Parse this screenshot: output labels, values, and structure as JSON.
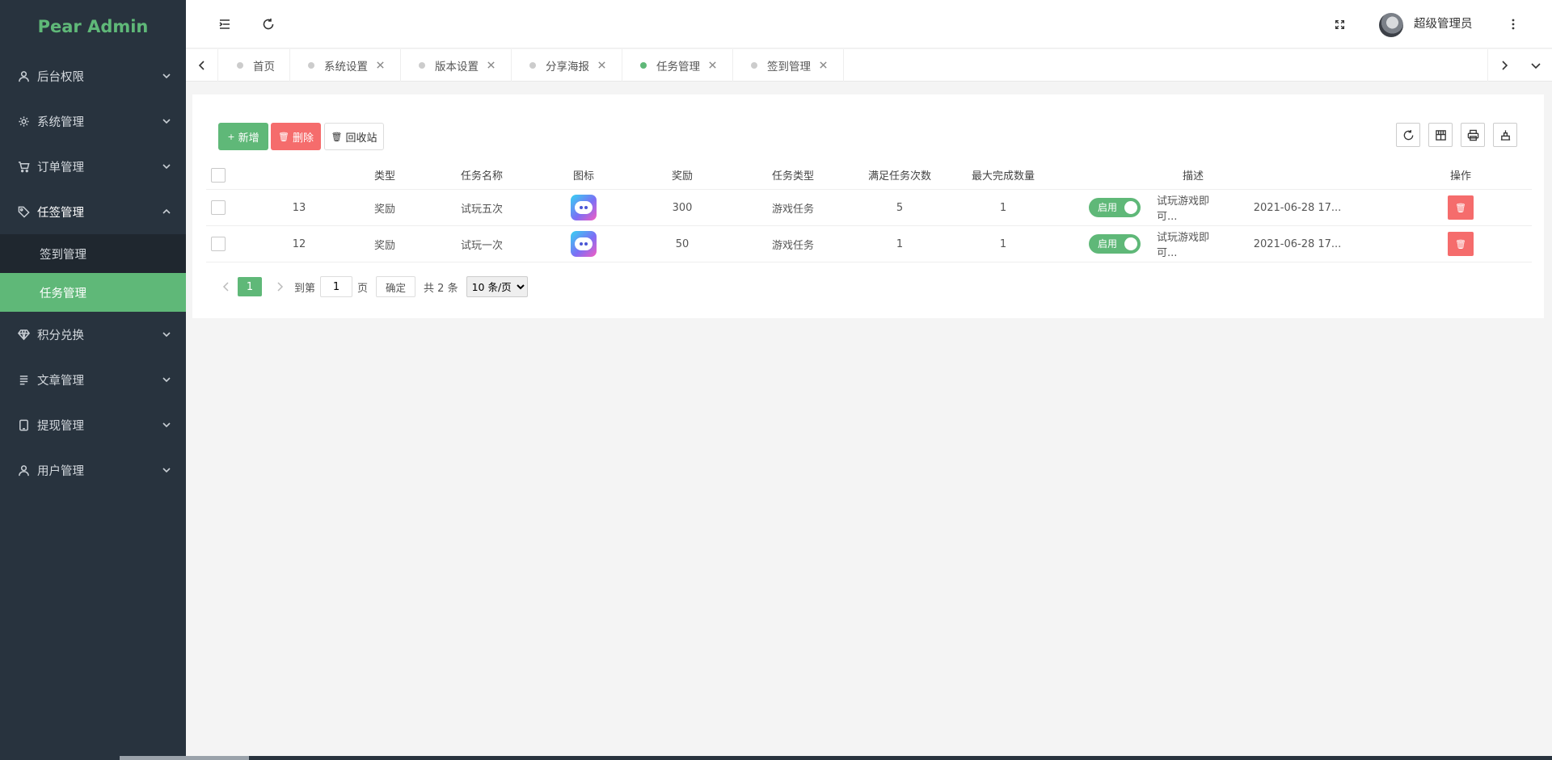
{
  "app": {
    "logo": "Pear Admin"
  },
  "sidebar": {
    "items": [
      {
        "label": "后台权限",
        "icon": "user-icon"
      },
      {
        "label": "系统管理",
        "icon": "gear-icon"
      },
      {
        "label": "订单管理",
        "icon": "cart-icon"
      },
      {
        "label": "任签管理",
        "icon": "tag-icon",
        "children": [
          {
            "label": "签到管理"
          },
          {
            "label": "任务管理",
            "active": true
          }
        ]
      },
      {
        "label": "积分兑换",
        "icon": "diamond-icon"
      },
      {
        "label": "文章管理",
        "icon": "article-icon"
      },
      {
        "label": "提现管理",
        "icon": "tablet-icon"
      },
      {
        "label": "用户管理",
        "icon": "user-icon"
      }
    ]
  },
  "header": {
    "username": "超级管理员"
  },
  "tabs": [
    {
      "label": "首页",
      "closable": false
    },
    {
      "label": "系统设置",
      "closable": true
    },
    {
      "label": "版本设置",
      "closable": true
    },
    {
      "label": "分享海报",
      "closable": true
    },
    {
      "label": "任务管理",
      "closable": true,
      "active": true
    },
    {
      "label": "签到管理",
      "closable": true
    }
  ],
  "toolbar": {
    "add_label": "新增",
    "delete_label": "删除",
    "recycle_label": "回收站"
  },
  "table": {
    "columns": [
      "类型",
      "任务名称",
      "图标",
      "奖励",
      "任务类型",
      "满足任务次数",
      "最大完成数量",
      "描述",
      "操作"
    ],
    "rows": [
      {
        "id": "13",
        "type": "奖励",
        "name": "试玩五次",
        "reward": "300",
        "task_type": "游戏任务",
        "times": "5",
        "max": "1",
        "status": "启用",
        "desc": "试玩游戏即可...",
        "date": "2021-06-28 17..."
      },
      {
        "id": "12",
        "type": "奖励",
        "name": "试玩一次",
        "reward": "50",
        "task_type": "游戏任务",
        "times": "1",
        "max": "1",
        "status": "启用",
        "desc": "试玩游戏即可...",
        "date": "2021-06-28 17..."
      }
    ]
  },
  "pagination": {
    "current": "1",
    "goto_label": "到第",
    "goto_value": "1",
    "page_label": "页",
    "confirm_label": "确定",
    "total_label": "共 2 条",
    "page_size": "10 条/页"
  },
  "colors": {
    "accent": "#5fb878",
    "danger": "#f56c6c",
    "sidebar": "#28333e"
  }
}
